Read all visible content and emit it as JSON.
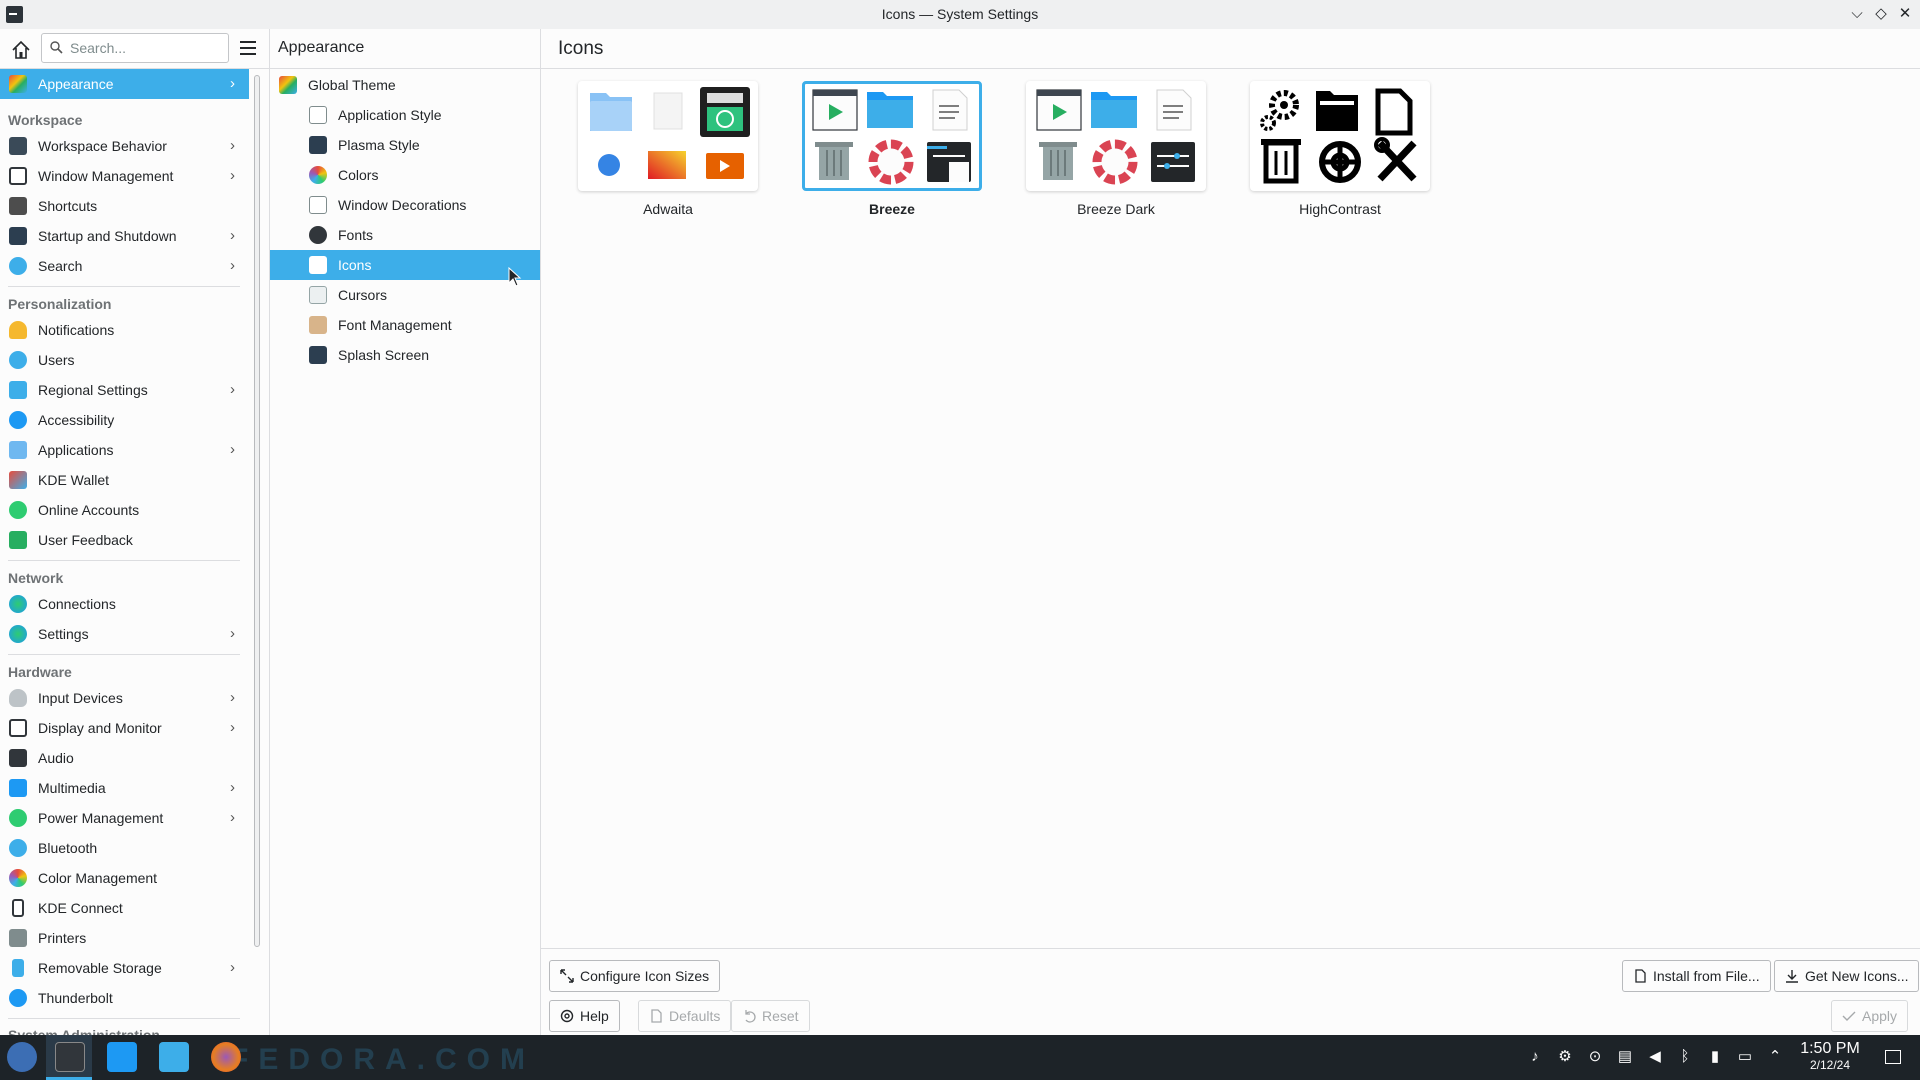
{
  "window": {
    "title": "Icons — System Settings"
  },
  "sidebar": {
    "search_placeholder": "Search...",
    "active": "Appearance",
    "appearance": "Appearance",
    "workspace_header": "Workspace",
    "workspace": [
      "Workspace Behavior",
      "Window Management",
      "Shortcuts",
      "Startup and Shutdown",
      "Search"
    ],
    "personalization_header": "Personalization",
    "personalization": [
      "Notifications",
      "Users",
      "Regional Settings",
      "Accessibility",
      "Applications",
      "KDE Wallet",
      "Online Accounts",
      "User Feedback"
    ],
    "network_header": "Network",
    "network": [
      "Connections",
      "Settings"
    ],
    "hardware_header": "Hardware",
    "hardware": [
      "Input Devices",
      "Display and Monitor",
      "Audio",
      "Multimedia",
      "Power Management",
      "Bluetooth",
      "Color Management",
      "KDE Connect",
      "Printers",
      "Removable Storage",
      "Thunderbolt"
    ],
    "system_admin_header": "System Administration"
  },
  "category": {
    "title": "Appearance",
    "items": [
      "Global Theme",
      "Application Style",
      "Plasma Style",
      "Colors",
      "Window Decorations",
      "Fonts",
      "Icons",
      "Cursors",
      "Font Management",
      "Splash Screen"
    ],
    "active": "Icons"
  },
  "content": {
    "title": "Icons",
    "themes": [
      "Adwaita",
      "Breeze",
      "Breeze Dark",
      "HighContrast"
    ],
    "selected_theme": "Breeze",
    "buttons": {
      "configure": "Configure Icon Sizes",
      "install": "Install from File...",
      "get_new": "Get New Icons...",
      "help": "Help",
      "defaults": "Defaults",
      "reset": "Reset",
      "apply": "Apply"
    }
  },
  "taskbar": {
    "time": "1:50 PM",
    "date": "2/12/24",
    "watermark": "FEDORA.COM"
  },
  "colors": {
    "accent": "#3daee9",
    "taskbar": "#1d2328"
  }
}
